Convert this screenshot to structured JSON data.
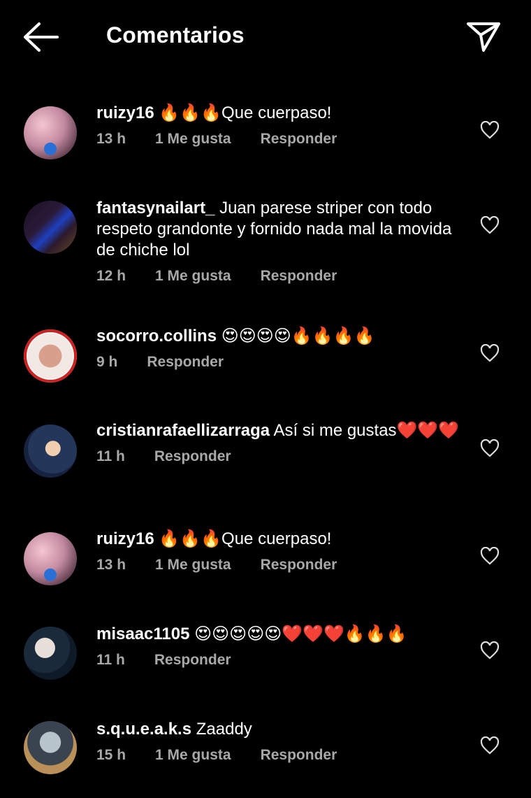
{
  "header": {
    "title": "Comentarios",
    "back_icon": "arrow-left-icon",
    "send_icon": "paper-plane-icon"
  },
  "comments": [
    {
      "username": "ruizy16",
      "text": " 🔥🔥🔥Que  cuerpaso!",
      "time": "13 h",
      "likes": "1 Me gusta",
      "reply": "Responder"
    },
    {
      "username": "fantasynailart_",
      "text": " Juan parese striper con todo respeto grandonte y fornido nada mal la movida de chiche lol",
      "time": "12 h",
      "likes": "1 Me gusta",
      "reply": "Responder"
    },
    {
      "username": "socorro.collins",
      "text": " 😍😍😍😍🔥🔥🔥🔥",
      "time": "9 h",
      "likes": "",
      "reply": "Responder"
    },
    {
      "username": "cristianrafaellizarraga",
      "text": " Así si me gustas❤️❤️❤️",
      "time": "11 h",
      "likes": "",
      "reply": "Responder"
    },
    {
      "username": "ruizy16",
      "text": " 🔥🔥🔥Que  cuerpaso!",
      "time": "13 h",
      "likes": "1 Me gusta",
      "reply": "Responder"
    },
    {
      "username": "misaac1105",
      "text": " 😍😍😍😍😍❤️❤️❤️🔥🔥🔥",
      "time": "11 h",
      "likes": "",
      "reply": "Responder"
    },
    {
      "username": "s.q.u.e.a.k.s",
      "text": " Zaaddy",
      "time": "15 h",
      "likes": "1 Me gusta",
      "reply": "Responder"
    }
  ]
}
